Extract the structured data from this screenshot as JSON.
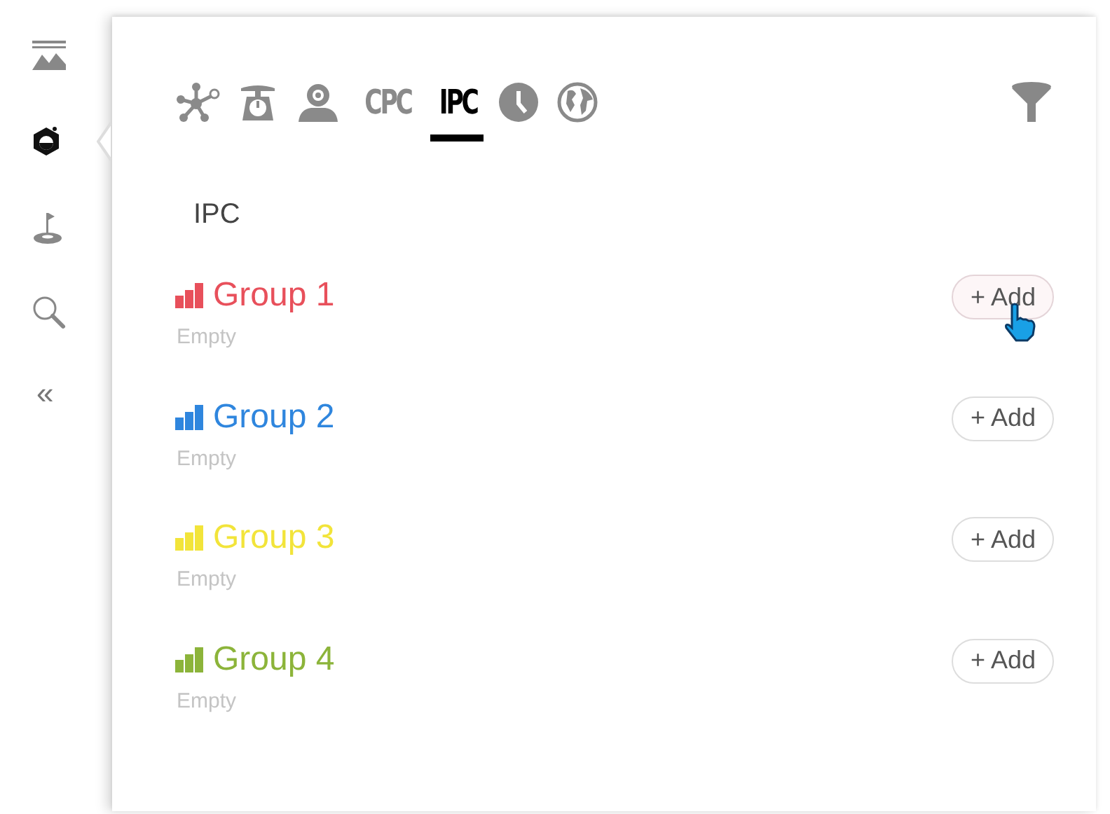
{
  "sidebar": {
    "items": [
      {
        "kind": "landscape",
        "selected": false
      },
      {
        "kind": "badge",
        "selected": true
      },
      {
        "kind": "flag",
        "selected": false
      },
      {
        "kind": "search",
        "selected": false
      }
    ],
    "collapse": "«"
  },
  "tabs": [
    {
      "kind": "network",
      "selected": false
    },
    {
      "kind": "scale",
      "selected": false
    },
    {
      "kind": "person",
      "selected": false
    },
    {
      "kind": "text",
      "label": "CPC",
      "selected": false
    },
    {
      "kind": "text",
      "label": "IPC",
      "selected": true
    },
    {
      "kind": "clock",
      "selected": false
    },
    {
      "kind": "globe",
      "selected": false
    }
  ],
  "section_title": "IPC",
  "groups": [
    {
      "name": "Group 1",
      "color": "#e8505b",
      "status": "Empty",
      "button": "+ Add",
      "hovered": true
    },
    {
      "name": "Group 2",
      "color": "#2f86de",
      "status": "Empty",
      "button": "+ Add",
      "hovered": false
    },
    {
      "name": "Group 3",
      "color": "#f2e43a",
      "status": "Empty",
      "button": "+ Add",
      "hovered": false
    },
    {
      "name": "Group 4",
      "color": "#8cb43a",
      "status": "Empty",
      "button": "+ Add",
      "hovered": false
    }
  ]
}
